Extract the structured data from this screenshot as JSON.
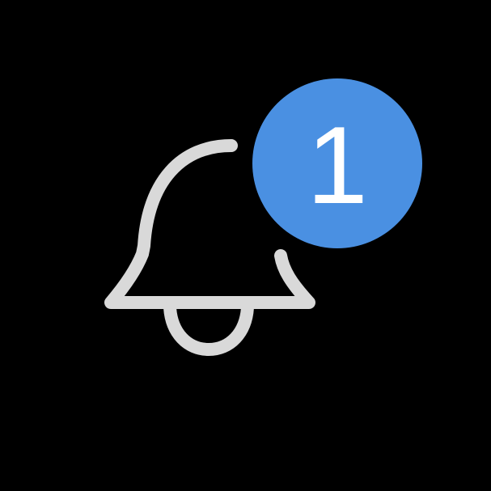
{
  "notifications": {
    "icon": "bell-icon",
    "badge_count": "1",
    "colors": {
      "background": "#000000",
      "icon_stroke": "#D9D9D9",
      "badge_fill": "#4A90E2",
      "badge_text": "#FFFFFF"
    }
  }
}
